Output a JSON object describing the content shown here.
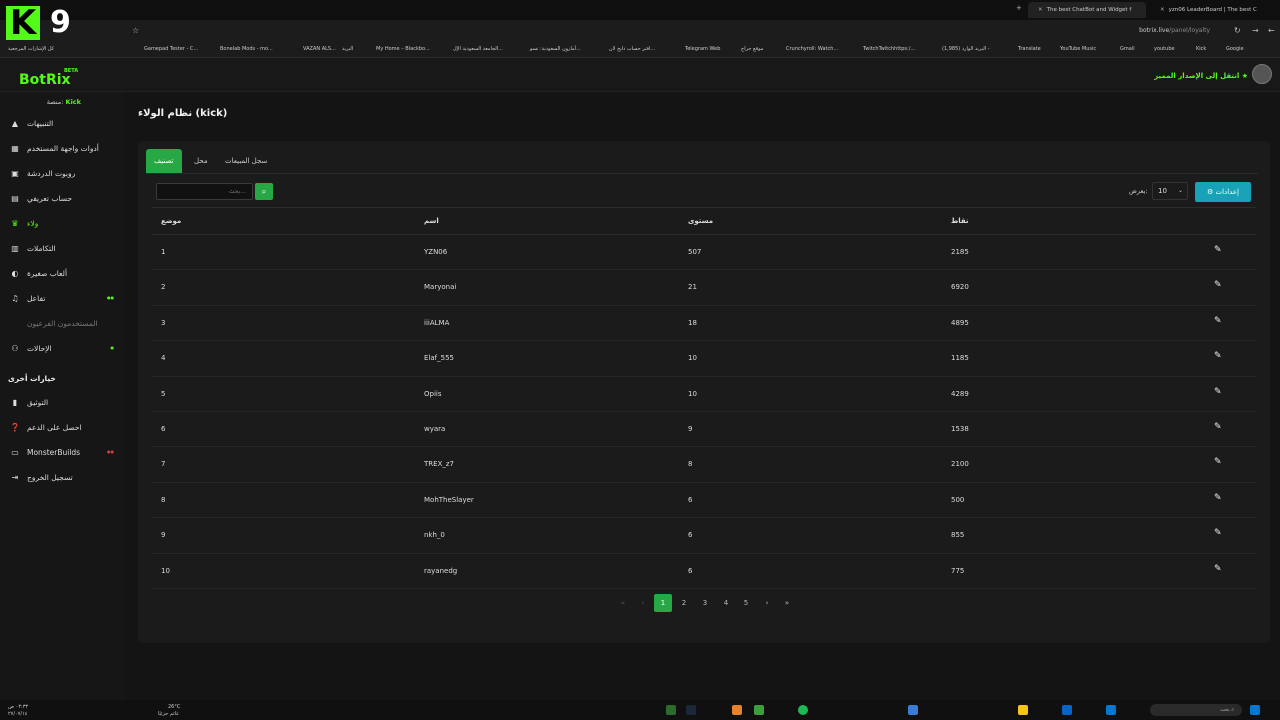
{
  "browser": {
    "tabs": [
      {
        "title": "The best ChatBot and Widget f"
      },
      {
        "title": "yzn06 LeaderBoard | The best C"
      }
    ],
    "url_domain": "botrix.live",
    "url_path": "/panel/loyalty",
    "bookmarks": [
      "كل الإشارات المرجعية",
      "Gamepad Tester - C...",
      "Bonelab Mods - mo...",
      "VAZAN ALS...",
      "البريد",
      "My Home – Blackbo...",
      "الجامعة السعودية الإل...",
      "أمازون السعودية: تسو...",
      "افتر حساب دايخ لان...",
      "Telegram Web",
      "موقع حراج",
      "Crunchyroll: Watch...",
      "TwitchTwitchhttps:/...",
      "(1,985) البريد الوارد -",
      "Translate",
      "YouTube Music",
      "Gmail",
      "youtube",
      "Kick",
      "Google"
    ]
  },
  "overlay": {
    "logo_letter": "K",
    "logo_number": "9"
  },
  "header": {
    "brand": "BotRix",
    "beta": "BETA",
    "upgrade": "انتقل إلى الإصدار المميز"
  },
  "sidebar": {
    "platform_label": "منصة:",
    "platform_value": "Kick",
    "items": [
      {
        "label": "التنبيهات",
        "icon": "warning-icon"
      },
      {
        "label": "أدوات واجهة المستخدم",
        "icon": "widgets-icon"
      },
      {
        "label": "روبوت الدردشة",
        "icon": "chatbot-icon"
      },
      {
        "label": "حساب تعريفي",
        "icon": "profile-icon"
      },
      {
        "label": "ولاء",
        "icon": "trophy-icon"
      },
      {
        "label": "التكاملات",
        "icon": "integrations-icon"
      },
      {
        "label": "ألعاب صغيرة",
        "icon": "gamepad-icon"
      },
      {
        "label": "تفاعل",
        "icon": "music-icon"
      },
      {
        "label": "المستخدمون الفرعيون",
        "icon": "subusers-icon"
      },
      {
        "label": "الإحالات",
        "icon": "referrals-icon"
      }
    ],
    "section_title": "خيارات أخرى",
    "other_items": [
      {
        "label": "التوثيق",
        "icon": "book-icon"
      },
      {
        "label": "احصل على الدعم",
        "icon": "help-icon"
      },
      {
        "label": "MonsterBuilds",
        "icon": "laptop-icon"
      },
      {
        "label": "تسجيل الخروج",
        "icon": "logout-icon"
      }
    ]
  },
  "main": {
    "title": "نظام الولاء (kick)",
    "tabs": [
      "تصنيف",
      "محل",
      "سجل المبيعات"
    ],
    "search_placeholder": "بحث...",
    "show_label": "يعرض:",
    "show_value": "10",
    "settings_label": "إعدادات",
    "columns": [
      "موضع",
      "اسم",
      "مستوى",
      "نقاط"
    ],
    "rows": [
      {
        "pos": "1",
        "name": "YZN06",
        "level": "507",
        "points": "2185"
      },
      {
        "pos": "2",
        "name": "Maryonai",
        "level": "21",
        "points": "6920"
      },
      {
        "pos": "3",
        "name": "iiiALMA",
        "level": "18",
        "points": "4895"
      },
      {
        "pos": "4",
        "name": "Elaf_555",
        "level": "10",
        "points": "1185"
      },
      {
        "pos": "5",
        "name": "Opiis",
        "level": "10",
        "points": "4289"
      },
      {
        "pos": "6",
        "name": "wyara",
        "level": "9",
        "points": "1538"
      },
      {
        "pos": "7",
        "name": "TREX_z7",
        "level": "8",
        "points": "2100"
      },
      {
        "pos": "8",
        "name": "MohTheSlayer",
        "level": "6",
        "points": "500"
      },
      {
        "pos": "9",
        "name": "nkh_0",
        "level": "6",
        "points": "855"
      },
      {
        "pos": "10",
        "name": "rayanedg",
        "level": "6",
        "points": "775"
      }
    ],
    "pages": [
      "1",
      "2",
      "3",
      "4",
      "5"
    ],
    "current_page": "1"
  },
  "taskbar": {
    "time": "٠٣:٣٣ ص",
    "date": "٢٧/٠٧/١٤",
    "weather_temp": "26°C",
    "weather_desc": "غائم جزئيًا",
    "search_label": "بحث"
  },
  "colors": {
    "accent": "#53fc18",
    "primary_green": "#28a745",
    "info": "#17a2b8"
  }
}
